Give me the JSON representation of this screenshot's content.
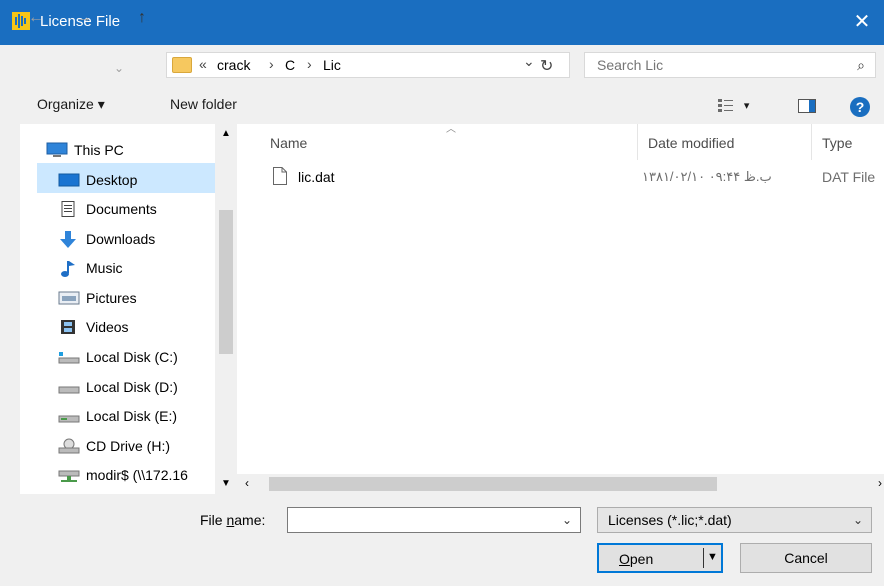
{
  "window": {
    "title": "License File",
    "close_glyph": "✕"
  },
  "nav": {
    "back_glyph": "←",
    "forward_glyph": "→",
    "recent_glyph": "⌄",
    "up_glyph": "↑",
    "address": {
      "overflow": "«",
      "parts": [
        "crack",
        "C",
        "Lic"
      ],
      "sep": "›",
      "dropdown": "⌄",
      "refresh": "↻"
    },
    "search_placeholder": "Search Lic",
    "search_glyph": "⌕"
  },
  "toolbar": {
    "organize": "Organize ▾",
    "new_folder": "New folder",
    "view_glyph": "▾",
    "help_glyph": "?"
  },
  "sidebar": {
    "items": [
      {
        "label": "This PC",
        "icon": "computer-icon"
      },
      {
        "label": "Desktop",
        "icon": "desktop-icon",
        "selected": true
      },
      {
        "label": "Documents",
        "icon": "documents-icon"
      },
      {
        "label": "Downloads",
        "icon": "downloads-icon"
      },
      {
        "label": "Music",
        "icon": "music-icon"
      },
      {
        "label": "Pictures",
        "icon": "pictures-icon"
      },
      {
        "label": "Videos",
        "icon": "videos-icon"
      },
      {
        "label": "Local Disk (C:)",
        "icon": "disk-c-icon"
      },
      {
        "label": "Local Disk (D:)",
        "icon": "disk-icon"
      },
      {
        "label": "Local Disk (E:)",
        "icon": "disk-icon"
      },
      {
        "label": "CD Drive (H:)",
        "icon": "cd-drive-icon"
      },
      {
        "label": "modir$ (\\\\172.16",
        "icon": "network-drive-icon"
      }
    ]
  },
  "file_list": {
    "columns": [
      "Name",
      "Date modified",
      "Type"
    ],
    "rows": [
      {
        "name": "lic.dat",
        "date": "۱۳۸۱/۰۲/۱۰ ب.ظ ۰۹:۴۴",
        "type": "DAT File"
      }
    ]
  },
  "bottom": {
    "file_name_label_pre": "File ",
    "file_name_label_u": "n",
    "file_name_label_post": "ame:",
    "file_name_value": "",
    "filter": "Licenses (*.lic;*.dat)",
    "open_u": "O",
    "open_rest": "pen",
    "cancel": "Cancel"
  },
  "colors": {
    "accent": "#0078d7",
    "titlebar": "#1a6ec0",
    "selection": "#cce8ff"
  }
}
